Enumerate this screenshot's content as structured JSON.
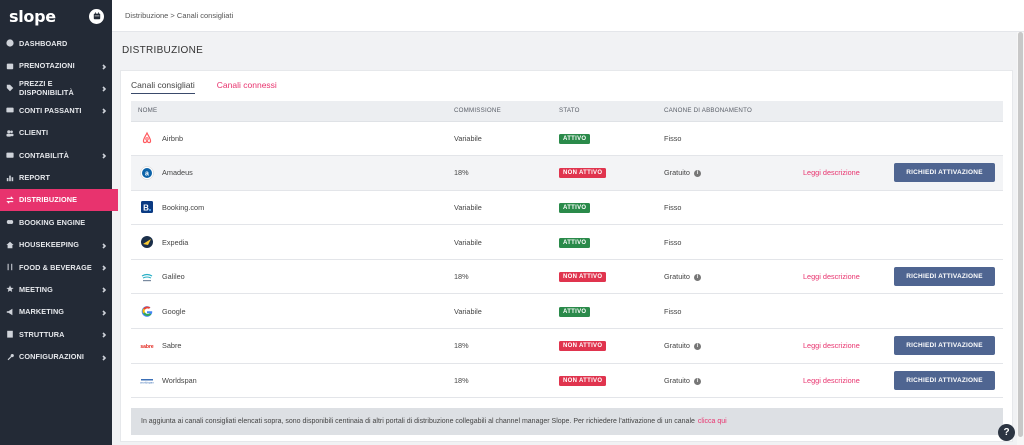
{
  "app": {
    "logo": "slope"
  },
  "sidebar": {
    "items": [
      {
        "label": "DASHBOARD",
        "icon": "dashboard-icon",
        "chevron": false,
        "active": false
      },
      {
        "label": "PRENOTAZIONI",
        "icon": "calendar-icon",
        "chevron": true,
        "active": false
      },
      {
        "label": "PREZZI E DISPONIBILITÀ",
        "icon": "tag-icon",
        "chevron": true,
        "active": false
      },
      {
        "label": "CONTI PASSANTI",
        "icon": "credit-card-icon",
        "chevron": true,
        "active": false
      },
      {
        "label": "CLIENTI",
        "icon": "users-icon",
        "chevron": false,
        "active": false
      },
      {
        "label": "CONTABILITÀ",
        "icon": "wallet-icon",
        "chevron": true,
        "active": false
      },
      {
        "label": "REPORT",
        "icon": "report-icon",
        "chevron": false,
        "active": false
      },
      {
        "label": "DISTRIBUZIONE",
        "icon": "exchange-icon",
        "chevron": false,
        "active": true
      },
      {
        "label": "BOOKING ENGINE",
        "icon": "link-icon",
        "chevron": false,
        "active": false
      },
      {
        "label": "HOUSEKEEPING",
        "icon": "home-icon",
        "chevron": true,
        "active": false
      },
      {
        "label": "FOOD & BEVERAGE",
        "icon": "cutlery-icon",
        "chevron": true,
        "active": false
      },
      {
        "label": "MEETING",
        "icon": "star-icon",
        "chevron": true,
        "active": false
      },
      {
        "label": "MARKETING",
        "icon": "megaphone-icon",
        "chevron": true,
        "active": false
      },
      {
        "label": "STRUTTURA",
        "icon": "building-icon",
        "chevron": true,
        "active": false
      },
      {
        "label": "CONFIGURAZIONI",
        "icon": "wrench-icon",
        "chevron": true,
        "active": false
      }
    ]
  },
  "breadcrumb": "Distribuzione > Canali consigliati",
  "page_title": "DISTRIBUZIONE",
  "tabs": [
    {
      "label": "Canali consigliati",
      "active": true
    },
    {
      "label": "Canali connessi",
      "active": false
    }
  ],
  "table": {
    "headers": [
      "NOME",
      "COMMISSIONE",
      "STATO",
      "CANONE DI ABBONAMENTO",
      "",
      ""
    ],
    "rows": [
      {
        "name": "Airbnb",
        "logo": "airbnb-logo-icon",
        "commission": "Variabile",
        "status": "ATTIVO",
        "active": true,
        "fee": "Fisso",
        "info": false,
        "link": "",
        "button": ""
      },
      {
        "name": "Amadeus",
        "logo": "amadeus-logo-icon",
        "commission": "18%",
        "status": "NON ATTIVO",
        "active": false,
        "fee": "Gratuito",
        "info": true,
        "link": "Leggi descrizione",
        "button": "RICHIEDI ATTIVAZIONE"
      },
      {
        "name": "Booking.com",
        "logo": "booking-logo-icon",
        "commission": "Variabile",
        "status": "ATTIVO",
        "active": true,
        "fee": "Fisso",
        "info": false,
        "link": "",
        "button": ""
      },
      {
        "name": "Expedia",
        "logo": "expedia-logo-icon",
        "commission": "Variabile",
        "status": "ATTIVO",
        "active": true,
        "fee": "Fisso",
        "info": false,
        "link": "",
        "button": ""
      },
      {
        "name": "Galileo",
        "logo": "galileo-logo-icon",
        "commission": "18%",
        "status": "NON ATTIVO",
        "active": false,
        "fee": "Gratuito",
        "info": true,
        "link": "Leggi descrizione",
        "button": "RICHIEDI ATTIVAZIONE"
      },
      {
        "name": "Google",
        "logo": "google-logo-icon",
        "commission": "Variabile",
        "status": "ATTIVO",
        "active": true,
        "fee": "Fisso",
        "info": false,
        "link": "",
        "button": ""
      },
      {
        "name": "Sabre",
        "logo": "sabre-logo-icon",
        "commission": "18%",
        "status": "NON ATTIVO",
        "active": false,
        "fee": "Gratuito",
        "info": true,
        "link": "Leggi descrizione",
        "button": "RICHIEDI ATTIVAZIONE"
      },
      {
        "name": "Worldspan",
        "logo": "worldspan-logo-icon",
        "commission": "18%",
        "status": "NON ATTIVO",
        "active": false,
        "fee": "Gratuito",
        "info": true,
        "link": "Leggi descrizione",
        "button": "RICHIEDI ATTIVAZIONE"
      }
    ]
  },
  "note": {
    "text": "In aggiunta ai canali consigliati elencati sopra, sono disponibili centinaia di altri portali di distribuzione collegabili al channel manager Slope. Per richiedere l'attivazione di un canale",
    "link": "clicca qui"
  },
  "help_label": "?",
  "colors": {
    "sidebar_bg": "#232a36",
    "accent": "#e8336e",
    "active_badge": "#2a8a4a",
    "inactive_badge": "#e0344e",
    "button": "#4f6591"
  }
}
